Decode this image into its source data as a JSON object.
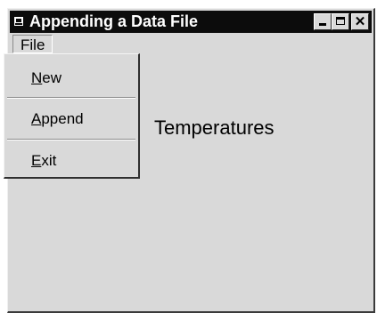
{
  "window": {
    "title": "Appending a Data File",
    "close_glyph": "✕"
  },
  "menu_bar": {
    "file_label": "File"
  },
  "file_menu": {
    "items": [
      {
        "accel": "N",
        "rest": "ew"
      },
      {
        "accel": "A",
        "rest": "ppend"
      },
      {
        "accel": "E",
        "rest": "xit"
      }
    ]
  },
  "main": {
    "label": "Temperatures"
  },
  "icons": {
    "app": "app-icon",
    "minimize": "minimize-icon",
    "maximize": "maximize-icon",
    "close": "close-icon"
  }
}
